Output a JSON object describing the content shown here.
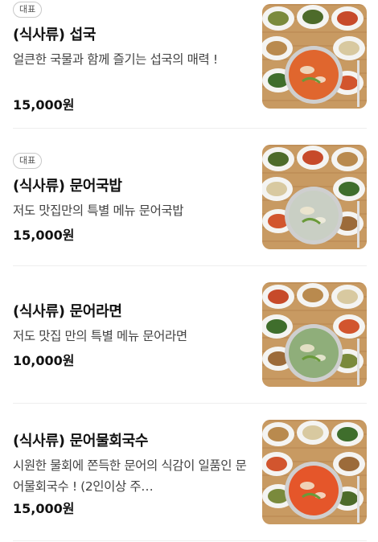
{
  "menu": [
    {
      "badge": "대표",
      "name": "(식사류) 섭국",
      "description": "얼큰한 국물과 함께 즐기는 섭국의 매력 !",
      "price": "15,000원",
      "image": "seopguk-set-photo",
      "soup_color": "#e0662e"
    },
    {
      "badge": "대표",
      "name": "(식사류) 문어국밥",
      "description": "저도 맛집만의 특별 메뉴 문어국밥",
      "price": "15,000원",
      "image": "octopus-gukbap-set-photo",
      "soup_color": "#c9cfc4"
    },
    {
      "badge": "",
      "name": "(식사류) 문어라면",
      "description": "저도 맛집 만의 특별 메뉴 문어라면",
      "price": "10,000원",
      "image": "octopus-ramen-set-photo",
      "soup_color": "#8fae7a"
    },
    {
      "badge": "",
      "name": "(식사류) 문어물회국수",
      "description": "시원한 물회에 쫀득한 문어의 식감이 일품인 문어물회국수 ! (2인이상 주…",
      "price": "15,000원",
      "image": "octopus-mulhoe-noodle-set-photo",
      "soup_color": "#e5562a"
    }
  ]
}
